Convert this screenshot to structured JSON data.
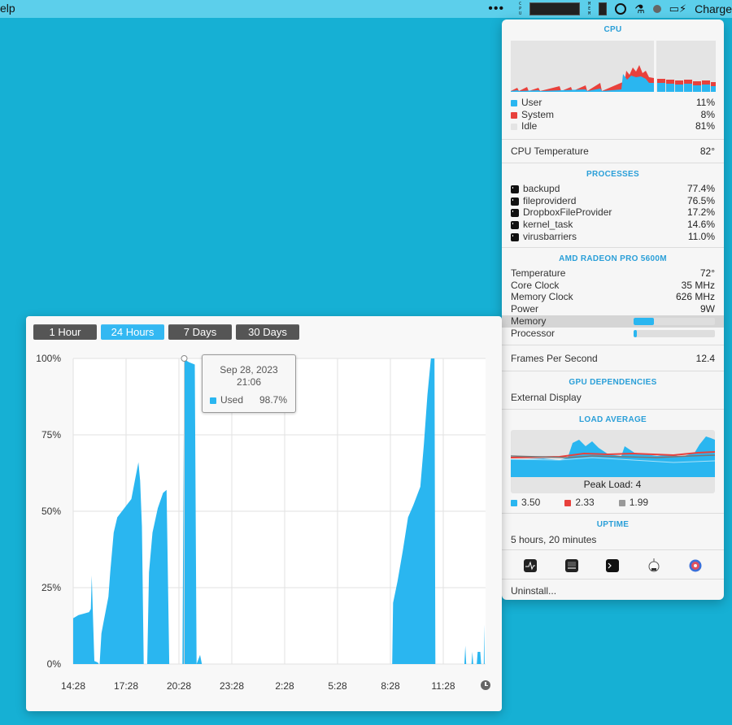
{
  "menubar": {
    "help_label": "elp",
    "more_label": "•••",
    "cpu_label": "CPU",
    "mem_label": "MEM",
    "charge_label": "Charge"
  },
  "panel": {
    "cpu": {
      "title": "CPU",
      "user_label": "User",
      "user_value": "11%",
      "system_label": "System",
      "system_value": "8%",
      "idle_label": "Idle",
      "idle_value": "81%",
      "temp_label": "CPU Temperature",
      "temp_value": "82°",
      "colors": {
        "user": "#2ab6f0",
        "system": "#e8413c",
        "idle": "#e4e4e4"
      }
    },
    "processes": {
      "title": "PROCESSES",
      "items": [
        {
          "name": "backupd",
          "value": "77.4%"
        },
        {
          "name": "fileproviderd",
          "value": "76.5%"
        },
        {
          "name": "DropboxFileProvider",
          "value": "17.2%"
        },
        {
          "name": "kernel_task",
          "value": "14.6%"
        },
        {
          "name": "virusbarriers",
          "value": "11.0%"
        }
      ]
    },
    "gpu": {
      "title": "AMD RADEON PRO 5600M",
      "temperature_label": "Temperature",
      "temperature_value": "72°",
      "core_label": "Core Clock",
      "core_value": "35 MHz",
      "memclock_label": "Memory Clock",
      "memclock_value": "626 MHz",
      "power_label": "Power",
      "power_value": "9W",
      "memory_label": "Memory",
      "memory_fill": 0.25,
      "processor_label": "Processor",
      "processor_fill": 0.04,
      "fps_label": "Frames Per Second",
      "fps_value": "12.4"
    },
    "gpu_deps": {
      "title": "GPU DEPENDENCIES",
      "item": "External Display"
    },
    "load": {
      "title": "LOAD AVERAGE",
      "peak_label": "Peak Load: 4",
      "v1": "3.50",
      "v2": "2.33",
      "v3": "1.99",
      "colors": [
        "#2ab6f0",
        "#e8413c",
        "#999999"
      ]
    },
    "uptime": {
      "title": "UPTIME",
      "value": "5 hours, 20 minutes"
    },
    "app_icons": [
      "activity-monitor-icon",
      "console-icon",
      "terminal-icon",
      "system-information-icon",
      "disk-utility-icon"
    ],
    "uninstall_label": "Uninstall..."
  },
  "chart": {
    "tabs": [
      "1 Hour",
      "24 Hours",
      "7 Days",
      "30 Days"
    ],
    "active_tab": 1,
    "tooltip": {
      "date": "Sep 28, 2023",
      "time": "21:06",
      "series": "Used",
      "value": "98.7%"
    }
  },
  "chart_data": {
    "type": "area",
    "series": [
      {
        "name": "Used",
        "color": "#2ab6f0"
      }
    ],
    "y_ticks": [
      "100%",
      "75%",
      "50%",
      "25%",
      "0%"
    ],
    "x_ticks": [
      "14:28",
      "17:28",
      "20:28",
      "23:28",
      "2:28",
      "5:28",
      "8:28",
      "11:28"
    ],
    "ylim": [
      0,
      100
    ],
    "grid": true,
    "points": [
      [
        0,
        15
      ],
      [
        0.3,
        16
      ],
      [
        0.6,
        16.5
      ],
      [
        0.9,
        17
      ],
      [
        1.0,
        18
      ],
      [
        1.05,
        29
      ],
      [
        1.1,
        20
      ],
      [
        1.2,
        1
      ],
      [
        1.4,
        0.5
      ],
      [
        1.45,
        0
      ],
      [
        1.5,
        0
      ],
      [
        1.6,
        10
      ],
      [
        1.7,
        13
      ],
      [
        2.0,
        22
      ],
      [
        2.1,
        30
      ],
      [
        2.3,
        43
      ],
      [
        2.5,
        48
      ],
      [
        2.9,
        51
      ],
      [
        3.3,
        54
      ],
      [
        3.5,
        60
      ],
      [
        3.7,
        66
      ],
      [
        3.8,
        60
      ],
      [
        3.9,
        45
      ],
      [
        4.0,
        0
      ],
      [
        4.2,
        0
      ],
      [
        4.3,
        30
      ],
      [
        4.5,
        43
      ],
      [
        4.8,
        51
      ],
      [
        5.1,
        56
      ],
      [
        5.3,
        57
      ],
      [
        5.45,
        0
      ],
      [
        6.2,
        0
      ],
      [
        6.3,
        100
      ],
      [
        6.5,
        99
      ],
      [
        6.6,
        98.7
      ],
      [
        6.9,
        98
      ],
      [
        7.0,
        0
      ],
      [
        7.2,
        3
      ],
      [
        7.3,
        0
      ],
      [
        18.1,
        0
      ],
      [
        18.15,
        20
      ],
      [
        18.4,
        27
      ],
      [
        18.7,
        37
      ],
      [
        19.0,
        48
      ],
      [
        19.3,
        52
      ],
      [
        19.7,
        58
      ],
      [
        19.9,
        72
      ],
      [
        20.1,
        88
      ],
      [
        20.3,
        100
      ],
      [
        20.5,
        100
      ],
      [
        20.55,
        0
      ],
      [
        22.2,
        0
      ],
      [
        22.25,
        6
      ],
      [
        22.3,
        0
      ],
      [
        22.6,
        0
      ],
      [
        22.65,
        4
      ],
      [
        22.7,
        0
      ],
      [
        22.9,
        0
      ],
      [
        22.95,
        4
      ],
      [
        23.1,
        4
      ],
      [
        23.15,
        0
      ],
      [
        23.3,
        0
      ],
      [
        23.32,
        13
      ],
      [
        23.35,
        0
      ]
    ]
  }
}
